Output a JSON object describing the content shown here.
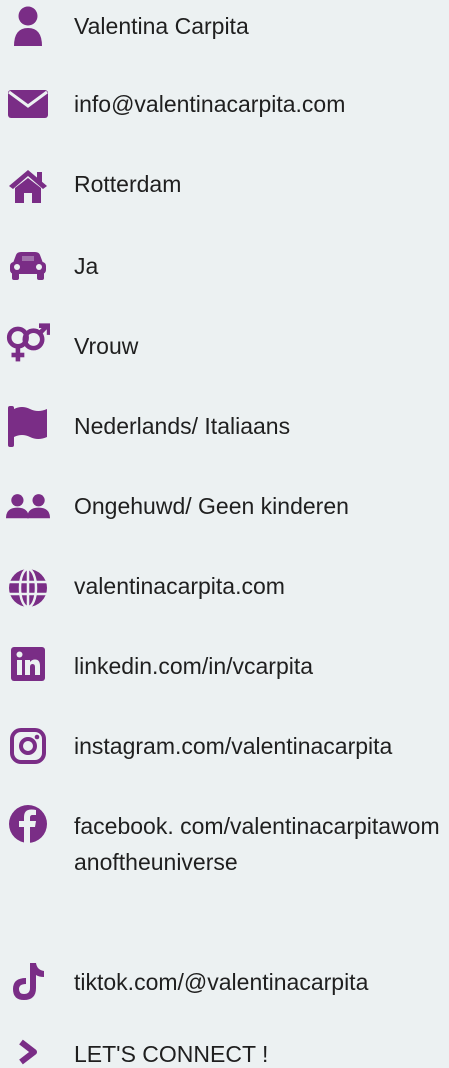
{
  "accent_color": "#7a2d86",
  "items": [
    {
      "icon": "user-icon",
      "text": "Valentina Carpita"
    },
    {
      "icon": "envelope-icon",
      "text": "info@valentinacarpita.com"
    },
    {
      "icon": "home-icon",
      "text": "Rotterdam"
    },
    {
      "icon": "car-icon",
      "text": "Ja"
    },
    {
      "icon": "gender-icon",
      "text": "Vrouw"
    },
    {
      "icon": "flag-icon",
      "text": "Nederlands/ Italiaans"
    },
    {
      "icon": "users-icon",
      "text": "Ongehuwd/ Geen kinderen"
    },
    {
      "icon": "globe-icon",
      "text": "valentinacarpita.com"
    },
    {
      "icon": "linkedin-icon",
      "text": "linkedin.com/in/vcarpita"
    },
    {
      "icon": "instagram-icon",
      "text": "instagram.com/valentinacarpita"
    },
    {
      "icon": "facebook-icon",
      "text": "facebook. com/valentinacarpitawomanoftheuniverse"
    },
    {
      "icon": "tiktok-icon",
      "text": "tiktok.com/@valentinacarpita"
    },
    {
      "icon": "chevron-right-icon",
      "text": "LET'S CONNECT !"
    }
  ]
}
